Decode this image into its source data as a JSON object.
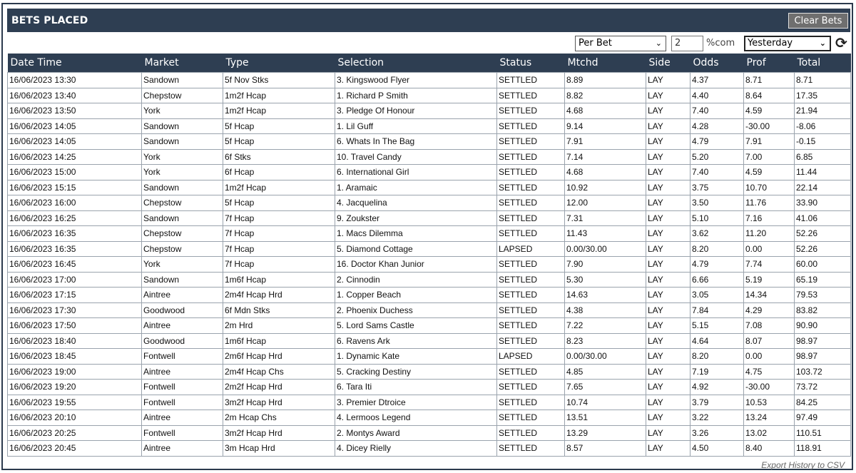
{
  "header": {
    "title": "BETS PLACED",
    "clear_label": "Clear Bets"
  },
  "controls": {
    "stake_mode": "Per Bet",
    "commission": "2",
    "commission_label": "%com",
    "period": "Yesterday"
  },
  "table": {
    "columns": [
      "Date Time",
      "Market",
      "Type",
      "Selection",
      "Status",
      "Mtchd",
      "Side",
      "Odds",
      "Prof",
      "Total"
    ],
    "rows": [
      [
        "16/06/2023 13:30",
        "Sandown",
        "5f Nov Stks",
        "3. Kingswood Flyer",
        "SETTLED",
        "8.89",
        "LAY",
        "4.37",
        "8.71",
        "8.71"
      ],
      [
        "16/06/2023 13:40",
        "Chepstow",
        "1m2f Hcap",
        "1. Richard P Smith",
        "SETTLED",
        "8.82",
        "LAY",
        "4.40",
        "8.64",
        "17.35"
      ],
      [
        "16/06/2023 13:50",
        "York",
        "1m2f Hcap",
        "3. Pledge Of Honour",
        "SETTLED",
        "4.68",
        "LAY",
        "7.40",
        "4.59",
        "21.94"
      ],
      [
        "16/06/2023 14:05",
        "Sandown",
        "5f Hcap",
        "1. Lil Guff",
        "SETTLED",
        "9.14",
        "LAY",
        "4.28",
        "-30.00",
        "-8.06"
      ],
      [
        "16/06/2023 14:05",
        "Sandown",
        "5f Hcap",
        "6. Whats In The Bag",
        "SETTLED",
        "7.91",
        "LAY",
        "4.79",
        "7.91",
        "-0.15"
      ],
      [
        "16/06/2023 14:25",
        "York",
        "6f Stks",
        "10. Travel Candy",
        "SETTLED",
        "7.14",
        "LAY",
        "5.20",
        "7.00",
        "6.85"
      ],
      [
        "16/06/2023 15:00",
        "York",
        "6f Hcap",
        "6. International Girl",
        "SETTLED",
        "4.68",
        "LAY",
        "7.40",
        "4.59",
        "11.44"
      ],
      [
        "16/06/2023 15:15",
        "Sandown",
        "1m2f Hcap",
        "1. Aramaic",
        "SETTLED",
        "10.92",
        "LAY",
        "3.75",
        "10.70",
        "22.14"
      ],
      [
        "16/06/2023 16:00",
        "Chepstow",
        "5f Hcap",
        "4. Jacquelina",
        "SETTLED",
        "12.00",
        "LAY",
        "3.50",
        "11.76",
        "33.90"
      ],
      [
        "16/06/2023 16:25",
        "Sandown",
        "7f Hcap",
        "9. Zoukster",
        "SETTLED",
        "7.31",
        "LAY",
        "5.10",
        "7.16",
        "41.06"
      ],
      [
        "16/06/2023 16:35",
        "Chepstow",
        "7f Hcap",
        "1. Macs Dilemma",
        "SETTLED",
        "11.43",
        "LAY",
        "3.62",
        "11.20",
        "52.26"
      ],
      [
        "16/06/2023 16:35",
        "Chepstow",
        "7f Hcap",
        "5. Diamond Cottage",
        "LAPSED",
        "0.00/30.00",
        "LAY",
        "8.20",
        "0.00",
        "52.26"
      ],
      [
        "16/06/2023 16:45",
        "York",
        "7f Hcap",
        "16. Doctor Khan Junior",
        "SETTLED",
        "7.90",
        "LAY",
        "4.79",
        "7.74",
        "60.00"
      ],
      [
        "16/06/2023 17:00",
        "Sandown",
        "1m6f Hcap",
        "2. Cinnodin",
        "SETTLED",
        "5.30",
        "LAY",
        "6.66",
        "5.19",
        "65.19"
      ],
      [
        "16/06/2023 17:15",
        "Aintree",
        "2m4f Hcap Hrd",
        "1. Copper Beach",
        "SETTLED",
        "14.63",
        "LAY",
        "3.05",
        "14.34",
        "79.53"
      ],
      [
        "16/06/2023 17:30",
        "Goodwood",
        "6f Mdn Stks",
        "2. Phoenix Duchess",
        "SETTLED",
        "4.38",
        "LAY",
        "7.84",
        "4.29",
        "83.82"
      ],
      [
        "16/06/2023 17:50",
        "Aintree",
        "2m Hrd",
        "5. Lord Sams Castle",
        "SETTLED",
        "7.22",
        "LAY",
        "5.15",
        "7.08",
        "90.90"
      ],
      [
        "16/06/2023 18:40",
        "Goodwood",
        "1m6f Hcap",
        "6. Ravens Ark",
        "SETTLED",
        "8.23",
        "LAY",
        "4.64",
        "8.07",
        "98.97"
      ],
      [
        "16/06/2023 18:45",
        "Fontwell",
        "2m6f Hcap Hrd",
        "1. Dynamic Kate",
        "LAPSED",
        "0.00/30.00",
        "LAY",
        "8.20",
        "0.00",
        "98.97"
      ],
      [
        "16/06/2023 19:00",
        "Aintree",
        "2m4f Hcap Chs",
        "5. Cracking Destiny",
        "SETTLED",
        "4.85",
        "LAY",
        "7.19",
        "4.75",
        "103.72"
      ],
      [
        "16/06/2023 19:20",
        "Fontwell",
        "2m2f Hcap Hrd",
        "6. Tara Iti",
        "SETTLED",
        "7.65",
        "LAY",
        "4.92",
        "-30.00",
        "73.72"
      ],
      [
        "16/06/2023 19:55",
        "Fontwell",
        "3m2f Hcap Hrd",
        "3. Premier Dtroice",
        "SETTLED",
        "10.74",
        "LAY",
        "3.79",
        "10.53",
        "84.25"
      ],
      [
        "16/06/2023 20:10",
        "Aintree",
        "2m Hcap Chs",
        "4. Lermoos Legend",
        "SETTLED",
        "13.51",
        "LAY",
        "3.22",
        "13.24",
        "97.49"
      ],
      [
        "16/06/2023 20:25",
        "Fontwell",
        "3m2f Hcap Hrd",
        "2. Montys Award",
        "SETTLED",
        "13.29",
        "LAY",
        "3.26",
        "13.02",
        "110.51"
      ],
      [
        "16/06/2023 20:45",
        "Aintree",
        "3m Hcap Hrd",
        "4. Dicey Rielly",
        "SETTLED",
        "8.57",
        "LAY",
        "4.50",
        "8.40",
        "118.91"
      ]
    ]
  },
  "footer": {
    "export_label": "Export History to CSV"
  },
  "icons": {
    "refresh": "refresh-icon",
    "dropdown": "chevron-down-icon"
  }
}
